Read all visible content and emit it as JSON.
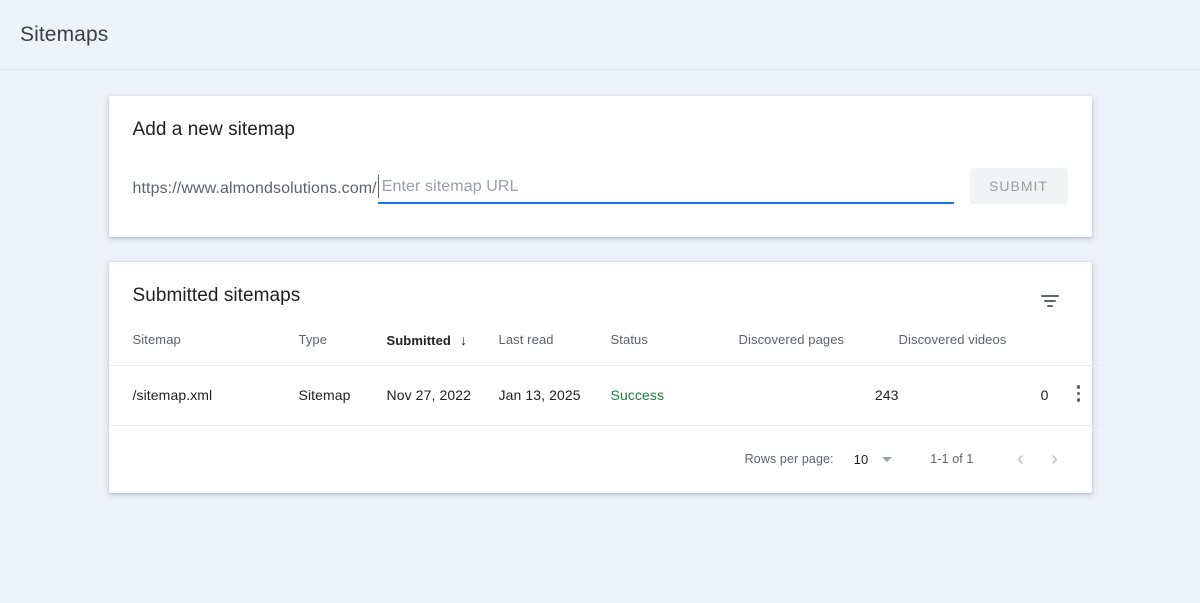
{
  "appbar": {
    "title": "Sitemaps"
  },
  "add_sitemap": {
    "title": "Add a new sitemap",
    "url_prefix": "https://www.almondsolutions.com/",
    "input_value": "",
    "placeholder": "Enter sitemap URL",
    "submit_label": "SUBMIT"
  },
  "submitted": {
    "title": "Submitted sitemaps",
    "filter_icon": "filter-icon",
    "columns": [
      {
        "label": "Sitemap",
        "sorted": false
      },
      {
        "label": "Type",
        "sorted": false
      },
      {
        "label": "Submitted",
        "sorted": true,
        "sort_arrow": "↓"
      },
      {
        "label": "Last read",
        "sorted": false
      },
      {
        "label": "Status",
        "sorted": false
      },
      {
        "label": "Discovered pages",
        "sorted": false
      },
      {
        "label": "Discovered videos",
        "sorted": false
      }
    ],
    "rows": [
      {
        "sitemap": "/sitemap.xml",
        "type": "Sitemap",
        "submitted": "Nov 27, 2022",
        "last_read": "Jan 13, 2025",
        "status": "Success",
        "status_color": "#188038",
        "discovered_pages": "243",
        "discovered_videos": "0",
        "actions_icon": "more-vert-icon"
      }
    ],
    "pagination": {
      "rows_per_page_label": "Rows per page:",
      "rows_per_page_value": "10",
      "range_label": "1-1 of 1",
      "prev_icon": "‹",
      "next_icon": "›"
    }
  },
  "theme": {
    "page_bg": "#eef2f9",
    "accent": "#1a73e8",
    "success": "#188038",
    "text_primary": "#202124",
    "text_secondary": "#5f6368"
  }
}
